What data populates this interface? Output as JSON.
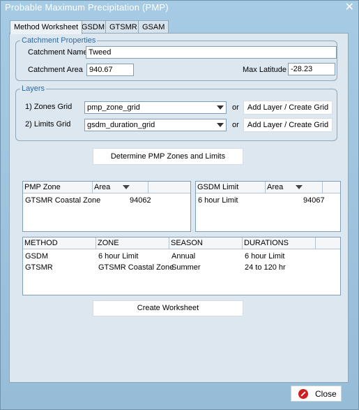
{
  "window": {
    "title": "Probable Maximum Precipitation (PMP)"
  },
  "tabs": [
    {
      "label": "Method Worksheet",
      "active": true
    },
    {
      "label": "GSDM"
    },
    {
      "label": "GTSMR"
    },
    {
      "label": "GSAM"
    }
  ],
  "catchment": {
    "legend": "Catchment Properties",
    "name_label": "Catchment Name",
    "name_value": "Tweed",
    "area_label": "Catchment Area",
    "area_value": "940.67",
    "lat_label": "Max Latitude",
    "lat_value": "-28.23"
  },
  "layers": {
    "legend": "Layers",
    "zones_label": "1) Zones Grid",
    "zones_value": "pmp_zone_grid",
    "limits_label": "2) Limits Grid",
    "limits_value": "gsdm_duration_grid",
    "or": "or",
    "add_layer_label": "Add Layer / Create Grid"
  },
  "determine_button": "Determine PMP Zones and Limits",
  "pmp_zone_table": {
    "columns": [
      "PMP Zone",
      "Area"
    ],
    "rows": [
      {
        "zone": "GTSMR Coastal Zone",
        "area": "94062"
      }
    ]
  },
  "gsdm_limit_table": {
    "columns": [
      "GSDM Limit",
      "Area"
    ],
    "rows": [
      {
        "limit": "6 hour Limit",
        "area": "94067"
      }
    ]
  },
  "method_table": {
    "columns": [
      "METHOD",
      "ZONE",
      "SEASON",
      "DURATIONS"
    ],
    "rows": [
      {
        "method": "GSDM",
        "zone": "6 hour Limit",
        "season": "Annual",
        "durations": "6 hour Limit"
      },
      {
        "method": "GTSMR",
        "zone": "GTSMR Coastal Zone",
        "season": "Summer",
        "durations": "24 to 120 hr"
      }
    ]
  },
  "create_button": "Create Worksheet",
  "close_button": "Close"
}
